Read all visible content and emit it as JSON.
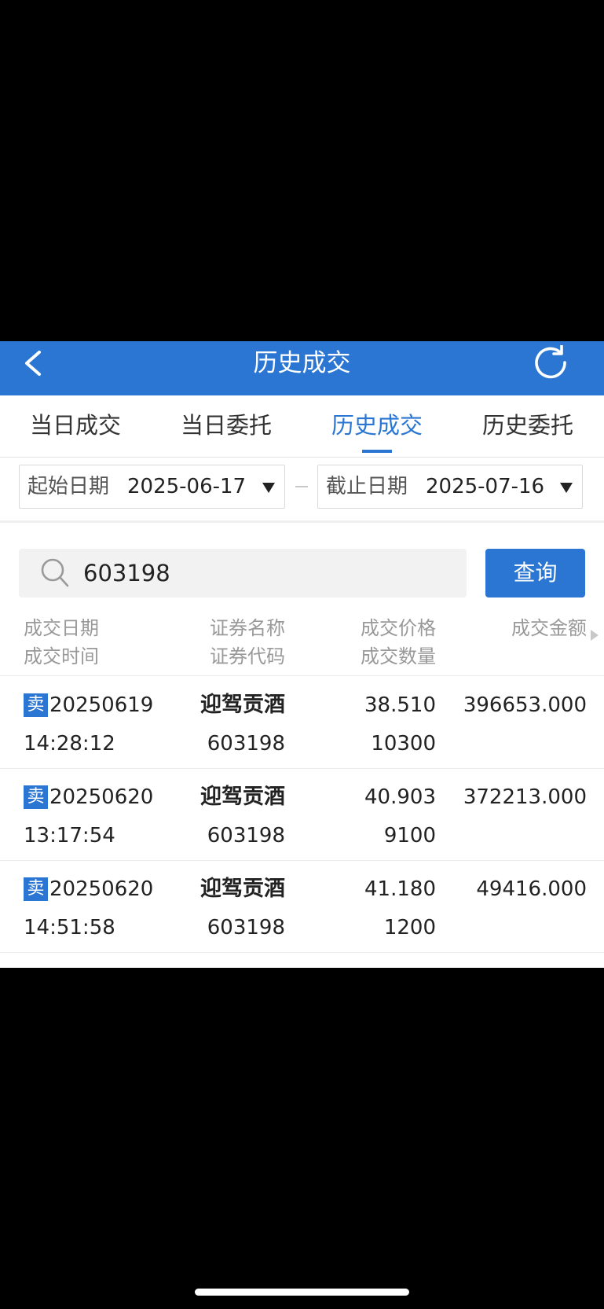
{
  "header": {
    "title": "历史成交"
  },
  "tabs": [
    {
      "label": "当日成交"
    },
    {
      "label": "当日委托"
    },
    {
      "label": "历史成交"
    },
    {
      "label": "历史委托"
    }
  ],
  "dates": {
    "start_label": "起始日期",
    "start_value": "2025-06-17",
    "end_label": "截止日期",
    "end_value": "2025-07-16"
  },
  "search": {
    "value": "603198",
    "button_label": "查询"
  },
  "columns": {
    "c1_top": "成交日期",
    "c1_bottom": "成交时间",
    "c2_top": "证券名称",
    "c2_bottom": "证券代码",
    "c3_top": "成交价格",
    "c3_bottom": "成交数量",
    "c4_top": "成交金额"
  },
  "rows": [
    {
      "side": "卖",
      "date": "20250619",
      "time": "14:28:12",
      "name": "迎驾贡酒",
      "code": "603198",
      "price": "38.510",
      "qty": "10300",
      "amount": "396653.000"
    },
    {
      "side": "卖",
      "date": "20250620",
      "time": "13:17:54",
      "name": "迎驾贡酒",
      "code": "603198",
      "price": "40.903",
      "qty": "9100",
      "amount": "372213.000"
    },
    {
      "side": "卖",
      "date": "20250620",
      "time": "14:51:58",
      "name": "迎驾贡酒",
      "code": "603198",
      "price": "41.180",
      "qty": "1200",
      "amount": "49416.000"
    }
  ]
}
